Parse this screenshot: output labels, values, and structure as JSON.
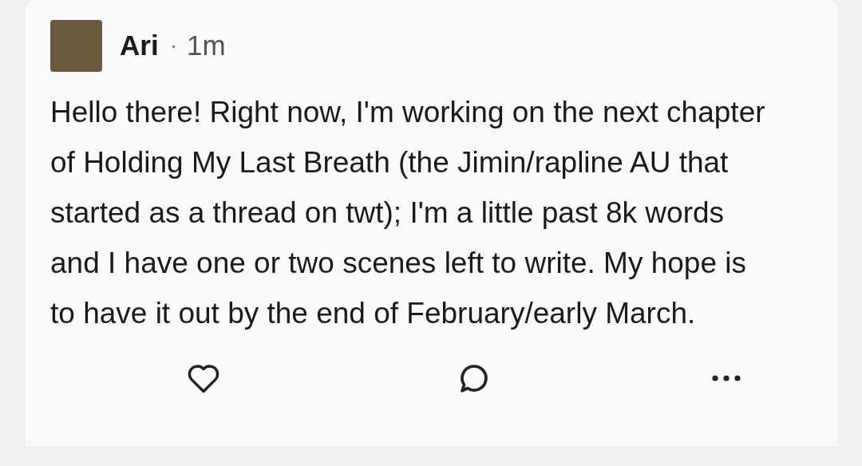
{
  "post": {
    "author": "Ari",
    "separator": "·",
    "time": "1m",
    "body": "Hello there! Right now, I'm working on the next chapter of Holding My Last Breath (the Jimin/rapline AU that started as a thread on twt); I'm a little past 8k words and I have one or two scenes left to write. My hope is to have it out by the end of February/early March.",
    "liked": false
  }
}
